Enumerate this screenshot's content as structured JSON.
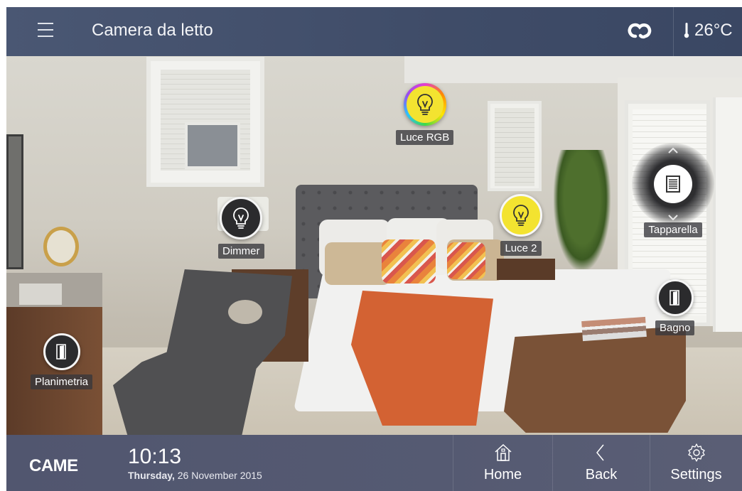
{
  "header": {
    "title": "Camera da letto",
    "temperature": "26°C"
  },
  "devices": {
    "luce_rgb": {
      "label": "Luce RGB"
    },
    "dimmer": {
      "label": "Dimmer"
    },
    "luce_2": {
      "label": "Luce 2"
    },
    "tapparella": {
      "label": "Tapparella"
    },
    "bagno": {
      "label": "Bagno"
    },
    "planimetria": {
      "label": "Planimetria"
    }
  },
  "footer": {
    "brand": "CAME",
    "time": "10:13",
    "day": "Thursday,",
    "date": "26 November 2015",
    "nav": {
      "home": "Home",
      "back": "Back",
      "settings": "Settings"
    }
  },
  "colors": {
    "header_bg": "#4a5773",
    "footer_bg": "#555a72",
    "light_on": "#f3e330"
  },
  "icons": {
    "menu": "menu-icon",
    "cloud": "cloud-icon",
    "thermometer": "thermometer-icon",
    "bulb": "bulb-icon",
    "shutter": "shutter-icon",
    "door": "door-icon",
    "home": "home-icon",
    "back": "chevron-left-icon",
    "settings": "gear-icon"
  }
}
